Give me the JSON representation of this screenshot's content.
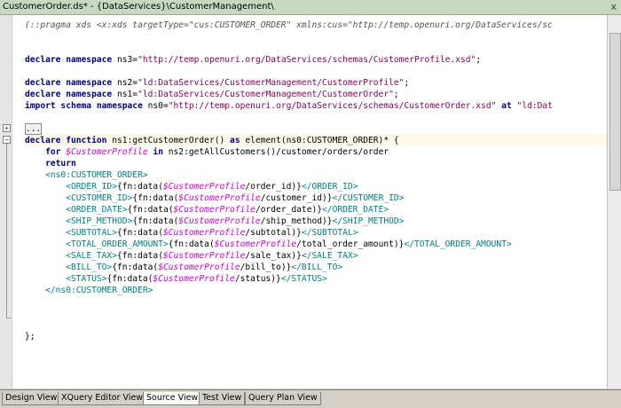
{
  "window": {
    "title": "CustomerOrder.ds* - {DataServices}\\CustomerManagement\\",
    "close_glyph": "x"
  },
  "editor": {
    "lines": [
      [
        [
          "cmt",
          "(::pragma xds <x:xds targetType=\"cus:CUSTOMER_ORDER\" xmlns:cus=\"http://temp.openuri.org/DataServices/sc"
        ]
      ],
      [],
      [],
      [
        [
          "kw",
          "declare namespace"
        ],
        [
          "n",
          " ns3="
        ],
        [
          "str",
          "\"http://temp.openuri.org/DataServices/schemas/CustomerProfile.xsd\""
        ],
        [
          "n",
          ";"
        ]
      ],
      [],
      [
        [
          "kw",
          "declare namespace"
        ],
        [
          "n",
          " ns2="
        ],
        [
          "str",
          "\"ld:DataServices/CustomerManagement/CustomerProfile\""
        ],
        [
          "n",
          ";"
        ]
      ],
      [
        [
          "kw",
          "declare namespace"
        ],
        [
          "n",
          " ns1="
        ],
        [
          "str",
          "\"ld:DataServices/CustomerManagement/CustomerOrder\""
        ],
        [
          "n",
          ";"
        ]
      ],
      [
        [
          "kw",
          "import schema namespace"
        ],
        [
          "n",
          " ns0="
        ],
        [
          "str",
          "\"http://temp.openuri.org/DataServices/schemas/CustomerOrder.xsd\""
        ],
        [
          "n",
          " "
        ],
        [
          "kw",
          "at"
        ],
        [
          "n",
          " "
        ],
        [
          "str",
          "\"ld:Dat"
        ]
      ],
      [],
      [
        [
          "ell",
          "..."
        ]
      ],
      [
        [
          "kw",
          "declare function"
        ],
        [
          "n",
          " ns1:getCustomerOrder() "
        ],
        [
          "kw",
          "as"
        ],
        [
          "n",
          " element(ns0:CUSTOMER_ORDER)* {"
        ]
      ],
      [
        [
          "n",
          "    "
        ],
        [
          "kw",
          "for"
        ],
        [
          "n",
          " "
        ],
        [
          "var",
          "$CustomerProfile"
        ],
        [
          "n",
          " "
        ],
        [
          "kw",
          "in"
        ],
        [
          "n",
          " ns2:getAllCustomers()/customer/orders/order"
        ]
      ],
      [
        [
          "n",
          "    "
        ],
        [
          "kw",
          "return"
        ]
      ],
      [
        [
          "n",
          "    "
        ],
        [
          "tag",
          "<ns0:CUSTOMER_ORDER>"
        ]
      ],
      [
        [
          "n",
          "        "
        ],
        [
          "tag",
          "<ORDER_ID>"
        ],
        [
          "n",
          "{fn:data("
        ],
        [
          "var",
          "$CustomerProfile"
        ],
        [
          "n",
          "/order_id)}"
        ],
        [
          "tag",
          "</ORDER_ID>"
        ]
      ],
      [
        [
          "n",
          "        "
        ],
        [
          "tag",
          "<CUSTOMER_ID>"
        ],
        [
          "n",
          "{fn:data("
        ],
        [
          "var",
          "$CustomerProfile"
        ],
        [
          "n",
          "/customer_id)}"
        ],
        [
          "tag",
          "</CUSTOMER_ID>"
        ]
      ],
      [
        [
          "n",
          "        "
        ],
        [
          "tag",
          "<ORDER_DATE>"
        ],
        [
          "n",
          "{fn:data("
        ],
        [
          "var",
          "$CustomerProfile"
        ],
        [
          "n",
          "/order_date)}"
        ],
        [
          "tag",
          "</ORDER_DATE>"
        ]
      ],
      [
        [
          "n",
          "        "
        ],
        [
          "tag",
          "<SHIP_METHOD>"
        ],
        [
          "n",
          "{fn:data("
        ],
        [
          "var",
          "$CustomerProfile"
        ],
        [
          "n",
          "/ship_method)}"
        ],
        [
          "tag",
          "</SHIP_METHOD>"
        ]
      ],
      [
        [
          "n",
          "        "
        ],
        [
          "tag",
          "<SUBTOTAL>"
        ],
        [
          "n",
          "{fn:data("
        ],
        [
          "var",
          "$CustomerProfile"
        ],
        [
          "n",
          "/subtotal)}"
        ],
        [
          "tag",
          "</SUBTOTAL>"
        ]
      ],
      [
        [
          "n",
          "        "
        ],
        [
          "tag",
          "<TOTAL_ORDER_AMOUNT>"
        ],
        [
          "n",
          "{fn:data("
        ],
        [
          "var",
          "$CustomerProfile"
        ],
        [
          "n",
          "/total_order_amount)}"
        ],
        [
          "tag",
          "</TOTAL_ORDER_AMOUNT>"
        ]
      ],
      [
        [
          "n",
          "        "
        ],
        [
          "tag",
          "<SALE_TAX>"
        ],
        [
          "n",
          "{fn:data("
        ],
        [
          "var",
          "$CustomerProfile"
        ],
        [
          "n",
          "/sale_tax)}"
        ],
        [
          "tag",
          "</SALE_TAX>"
        ]
      ],
      [
        [
          "n",
          "        "
        ],
        [
          "tag",
          "<BILL_TO>"
        ],
        [
          "n",
          "{fn:data("
        ],
        [
          "var",
          "$CustomerProfile"
        ],
        [
          "n",
          "/bill_to)}"
        ],
        [
          "tag",
          "</BILL_TO>"
        ]
      ],
      [
        [
          "n",
          "        "
        ],
        [
          "tag",
          "<STATUS>"
        ],
        [
          "n",
          "{fn:data("
        ],
        [
          "var",
          "$CustomerProfile"
        ],
        [
          "n",
          "/status)}"
        ],
        [
          "tag",
          "</STATUS>"
        ]
      ],
      [
        [
          "n",
          "    "
        ],
        [
          "tag",
          "</ns0:CUSTOMER_ORDER>"
        ]
      ],
      [],
      [],
      [],
      [
        [
          "n",
          "};"
        ]
      ]
    ]
  },
  "tabs": [
    {
      "label": "Design View",
      "active": false
    },
    {
      "label": "XQuery Editor View",
      "active": false
    },
    {
      "label": "Source View",
      "active": true
    },
    {
      "label": "Test View",
      "active": false
    },
    {
      "label": "Query Plan View",
      "active": false
    }
  ]
}
